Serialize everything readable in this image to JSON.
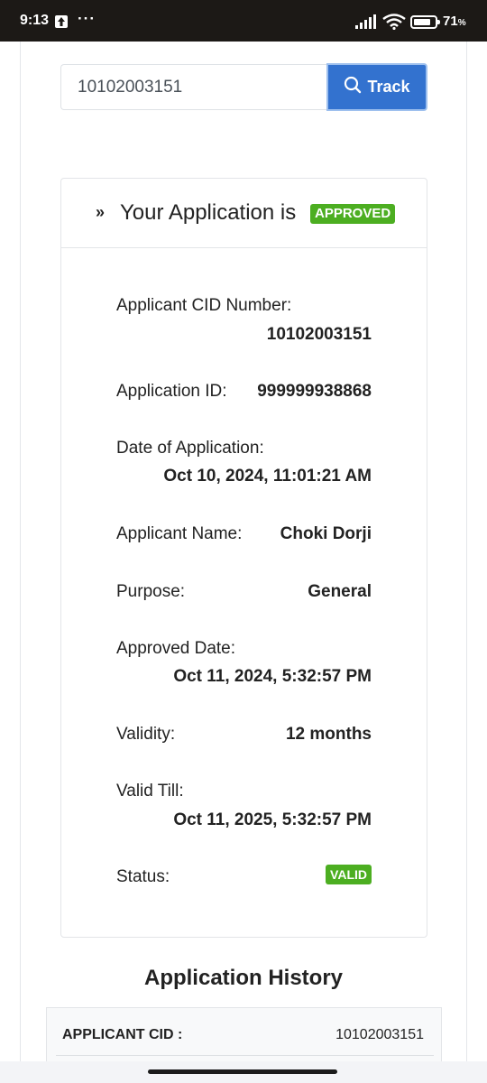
{
  "status_bar": {
    "time": "9:13",
    "more": "···",
    "battery_level": "71",
    "battery_unit": "%"
  },
  "search": {
    "value": "10102003151",
    "button_label": "Track"
  },
  "card": {
    "header_chevron": "»",
    "header_text": "Your Application is",
    "status_badge": "APPROVED",
    "fields": {
      "cid_label": "Applicant CID Number:",
      "cid_value": "10102003151",
      "app_id_label": "Application ID:",
      "app_id_value": "999999938868",
      "date_label": "Date of Application:",
      "date_value": "Oct 10, 2024, 11:01:21 AM",
      "name_label": "Applicant Name:",
      "name_value": "Choki Dorji",
      "purpose_label": "Purpose:",
      "purpose_value": "General",
      "approved_label": "Approved Date:",
      "approved_value": "Oct 11, 2024, 5:32:57 PM",
      "validity_label": "Validity:",
      "validity_value": "12 months",
      "valid_till_label": "Valid Till:",
      "valid_till_value": "Oct 11, 2025, 5:32:57 PM",
      "status_label": "Status:",
      "status_value": "VALID"
    }
  },
  "history": {
    "title": "Application History",
    "cid_label": "APPLICANT CID :",
    "cid_value": "10102003151"
  },
  "colors": {
    "primary": "#3372cf",
    "success": "#4cae21",
    "status_bar_bg": "#1c1916"
  }
}
